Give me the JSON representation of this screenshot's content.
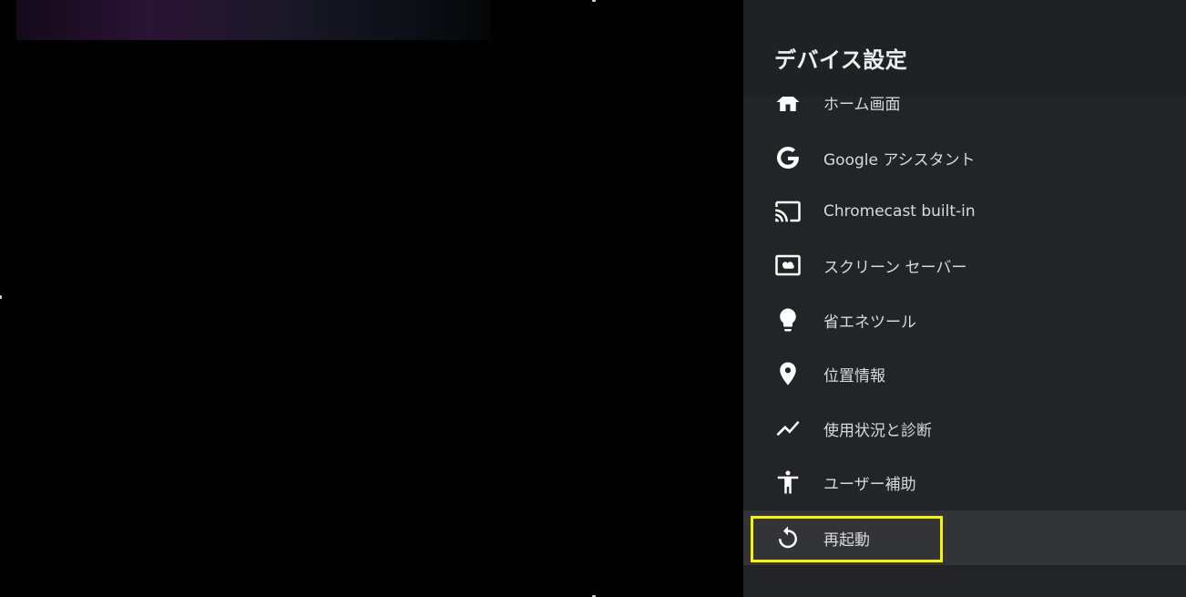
{
  "panel": {
    "title": "デバイス設定"
  },
  "menu": {
    "items": [
      {
        "label": "ホーム画面",
        "icon": "home-icon"
      },
      {
        "label": "Google アシスタント",
        "icon": "google-g-icon"
      },
      {
        "label": "Chromecast built-in",
        "icon": "cast-icon"
      },
      {
        "label": "スクリーン セーバー",
        "icon": "screensaver-icon"
      },
      {
        "label": "省エネツール",
        "icon": "lightbulb-icon"
      },
      {
        "label": "位置情報",
        "icon": "location-pin-icon"
      },
      {
        "label": "使用状況と診断",
        "icon": "trending-line-icon"
      },
      {
        "label": "ユーザー補助",
        "icon": "accessibility-icon"
      },
      {
        "label": "再起動",
        "icon": "restart-icon"
      }
    ],
    "selected_index": 8
  },
  "colors": {
    "panel_bg": "#202124",
    "list_bg": "#232427",
    "selected_bg": "#333438",
    "highlight": "#f5f500",
    "text": "#d9d9d9"
  }
}
